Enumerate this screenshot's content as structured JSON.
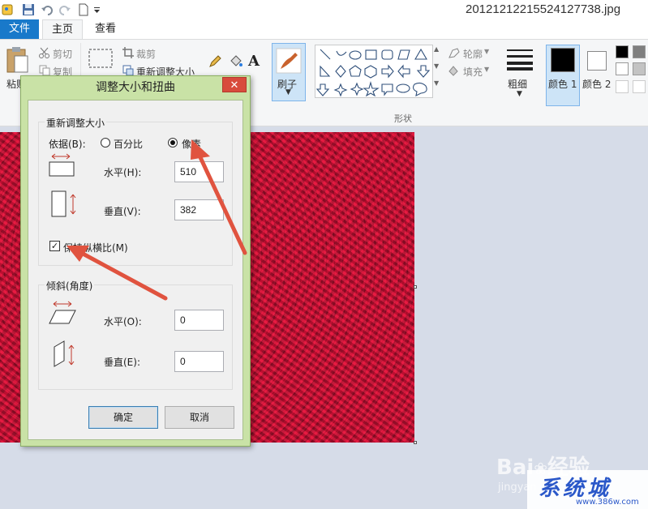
{
  "window": {
    "title": "20121212215524127738.jpg"
  },
  "ribbon_tabs": {
    "file": "文件",
    "home": "主页",
    "view": "查看"
  },
  "ribbon": {
    "paste": "粘贴",
    "cut": "剪切",
    "copy": "复制",
    "crop": "裁剪",
    "resize": "重新调整大小",
    "brush": "刷子",
    "outline": "轮廓",
    "fill": "填充",
    "shapes_group": "形状",
    "size": "粗细",
    "color1": "颜色 1",
    "color2": "颜色 2"
  },
  "dialog": {
    "title": "调整大小和扭曲",
    "close": "✕",
    "resize_group": "重新调整大小",
    "by_label": "依据(B):",
    "percent_option": "百分比",
    "pixel_option": "像素",
    "selected_option": "像素",
    "horizontal_label": "水平(H):",
    "horizontal_value": "510",
    "vertical_label": "垂直(V):",
    "vertical_value": "382",
    "keep_ratio_label": "保持纵横比(M)",
    "keep_ratio_checked": true,
    "skew_group": "倾斜(角度)",
    "skew_horizontal_label": "水平(O):",
    "skew_horizontal_value": "0",
    "skew_vertical_label": "垂直(E):",
    "skew_vertical_value": "0",
    "ok": "确定",
    "cancel": "取消"
  },
  "watermark": {
    "baidu": "Bai",
    "jingyan": "经验",
    "jingyan_url": "jingyan",
    "site_logo": "系统城",
    "site_url": "www.386w.com"
  },
  "colors": {
    "accent": "#1979ca",
    "dialog_frame": "#c9e2a6",
    "close_red": "#d84b3c",
    "arrow_red": "#e0533f"
  }
}
